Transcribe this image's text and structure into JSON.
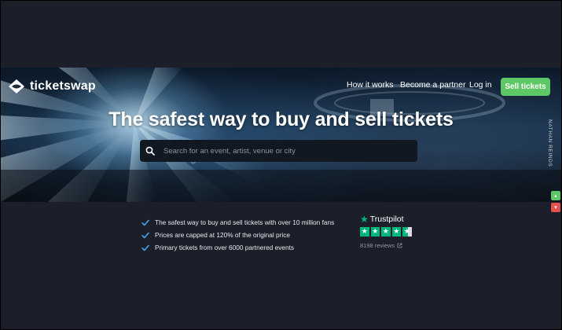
{
  "brand": {
    "name": "ticketswap"
  },
  "nav": {
    "links": [
      "How it works",
      "Become a partner",
      "Log in"
    ],
    "cta": "Sell tickets"
  },
  "hero": {
    "headline": "The safest way to buy and sell tickets",
    "search_placeholder": "Search for an event, artist, venue or city",
    "photo_credit": "NATHAN REINDS"
  },
  "features": [
    "The safest way to buy and sell tickets with over 10 million fans",
    "Prices are capped at 120% of the original price",
    "Primary tickets from over 6000 partnered events"
  ],
  "trustpilot": {
    "name": "Trustpilot",
    "rating_stars": 4.5,
    "reviews": "8198 reviews"
  },
  "colors": {
    "background": "#1c1f2a",
    "accent_green": "#5ec766",
    "trustpilot_green": "#00b67a",
    "feedback_red": "#e5504d"
  },
  "icons": {
    "logo": "ticketswap-logo-icon",
    "search": "search-icon",
    "check": "check-icon",
    "external": "external-link-icon",
    "feedback_up": "thumbs-up-icon",
    "feedback_down": "thumbs-down-icon"
  }
}
